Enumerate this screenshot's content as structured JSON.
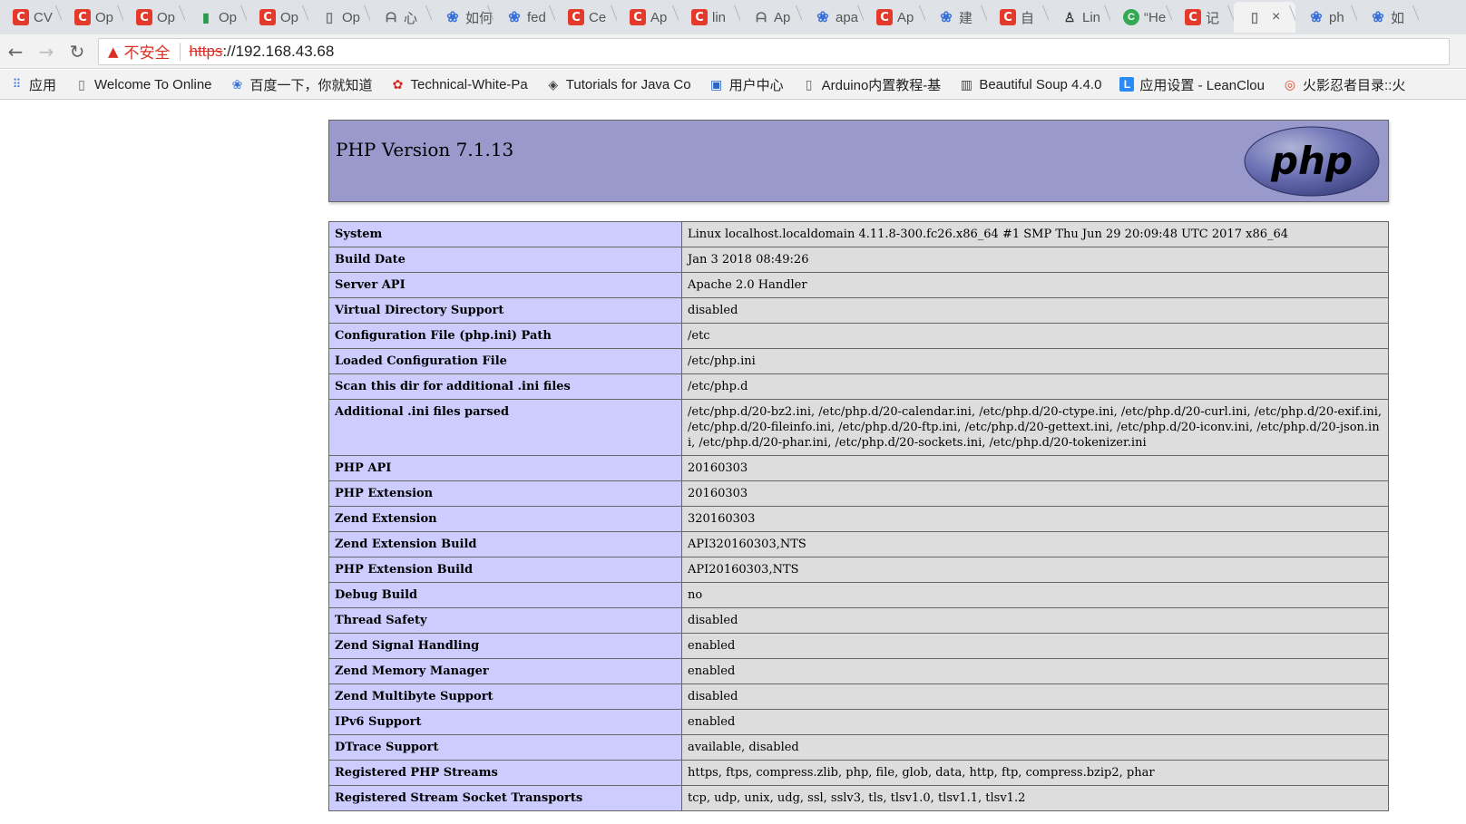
{
  "tabs": [
    {
      "label": "CV",
      "icon": "csdn-icon"
    },
    {
      "label": "Op",
      "icon": "csdn-icon"
    },
    {
      "label": "Op",
      "icon": "csdn-icon"
    },
    {
      "label": "Op",
      "icon": "bars-icon"
    },
    {
      "label": "Op",
      "icon": "csdn-icon"
    },
    {
      "label": "Op",
      "icon": "document-icon"
    },
    {
      "label": "心",
      "icon": "wing-icon"
    },
    {
      "label": "如何",
      "icon": "baidu-paw-icon"
    },
    {
      "label": "fed",
      "icon": "baidu-paw-icon"
    },
    {
      "label": "Ce",
      "icon": "csdn-icon"
    },
    {
      "label": "Ap",
      "icon": "csdn-icon"
    },
    {
      "label": "lin",
      "icon": "csdn-icon"
    },
    {
      "label": "Ap",
      "icon": "wing-icon"
    },
    {
      "label": "apa",
      "icon": "baidu-paw-icon"
    },
    {
      "label": "Ap",
      "icon": "csdn-icon"
    },
    {
      "label": "建",
      "icon": "baidu-paw-icon"
    },
    {
      "label": "自",
      "icon": "csdn-icon"
    },
    {
      "label": "Lin",
      "icon": "tux-icon"
    },
    {
      "label": "“He",
      "icon": "green-circle-icon"
    },
    {
      "label": "记",
      "icon": "csdn-icon"
    },
    {
      "label": "",
      "icon": "document-icon",
      "active": true
    },
    {
      "label": "ph",
      "icon": "baidu-paw-icon"
    },
    {
      "label": "如",
      "icon": "baidu-paw-icon"
    }
  ],
  "active_tab_close": "×",
  "nav": {
    "back": "←",
    "forward": "→",
    "reload": "↻"
  },
  "address": {
    "warning_icon": "▲",
    "insecure_label": "不安全",
    "scheme": "https",
    "rest": "://192.168.43.68"
  },
  "bookmarks": [
    {
      "label": "应用",
      "icon": "apps-grid-icon"
    },
    {
      "label": "Welcome To Online",
      "icon": "document-icon"
    },
    {
      "label": "百度一下，你就知道",
      "icon": "baidu-paw-icon"
    },
    {
      "label": "Technical-White-Pa",
      "icon": "huawei-icon"
    },
    {
      "label": "Tutorials for Java Co",
      "icon": "diamond-icon"
    },
    {
      "label": "用户中心",
      "icon": "user-center-icon"
    },
    {
      "label": "Arduino内置教程-基",
      "icon": "document-icon"
    },
    {
      "label": "Beautiful Soup 4.4.0",
      "icon": "book-icon"
    },
    {
      "label": "应用设置 - LeanClou",
      "icon": "leancloud-icon"
    },
    {
      "label": "火影忍者目录::火",
      "icon": "swirl-icon"
    }
  ],
  "php": {
    "version_title": "PHP Version 7.1.13",
    "logo_text": "php"
  },
  "info_rows": [
    {
      "key": "System",
      "value": "Linux localhost.localdomain 4.11.8-300.fc26.x86_64 #1 SMP Thu Jun 29 20:09:48 UTC 2017 x86_64"
    },
    {
      "key": "Build Date",
      "value": "Jan 3 2018 08:49:26"
    },
    {
      "key": "Server API",
      "value": "Apache 2.0 Handler"
    },
    {
      "key": "Virtual Directory Support",
      "value": "disabled"
    },
    {
      "key": "Configuration File (php.ini) Path",
      "value": "/etc"
    },
    {
      "key": "Loaded Configuration File",
      "value": "/etc/php.ini"
    },
    {
      "key": "Scan this dir for additional .ini files",
      "value": "/etc/php.d"
    },
    {
      "key": "Additional .ini files parsed",
      "value": "/etc/php.d/20-bz2.ini, /etc/php.d/20-calendar.ini, /etc/php.d/20-ctype.ini, /etc/php.d/20-curl.ini, /etc/php.d/20-exif.ini, /etc/php.d/20-fileinfo.ini, /etc/php.d/20-ftp.ini, /etc/php.d/20-gettext.ini, /etc/php.d/20-iconv.ini, /etc/php.d/20-json.ini, /etc/php.d/20-phar.ini, /etc/php.d/20-sockets.ini, /etc/php.d/20-tokenizer.ini"
    },
    {
      "key": "PHP API",
      "value": "20160303"
    },
    {
      "key": "PHP Extension",
      "value": "20160303"
    },
    {
      "key": "Zend Extension",
      "value": "320160303"
    },
    {
      "key": "Zend Extension Build",
      "value": "API320160303,NTS"
    },
    {
      "key": "PHP Extension Build",
      "value": "API20160303,NTS"
    },
    {
      "key": "Debug Build",
      "value": "no"
    },
    {
      "key": "Thread Safety",
      "value": "disabled"
    },
    {
      "key": "Zend Signal Handling",
      "value": "enabled"
    },
    {
      "key": "Zend Memory Manager",
      "value": "enabled"
    },
    {
      "key": "Zend Multibyte Support",
      "value": "disabled"
    },
    {
      "key": "IPv6 Support",
      "value": "enabled"
    },
    {
      "key": "DTrace Support",
      "value": "available, disabled"
    },
    {
      "key": "Registered PHP Streams",
      "value": "https, ftps, compress.zlib, php, file, glob, data, http, ftp, compress.bzip2, phar"
    },
    {
      "key": "Registered Stream Socket Transports",
      "value": "tcp, udp, unix, udg, ssl, sslv3, tls, tlsv1.0, tlsv1.1, tlsv1.2"
    }
  ]
}
